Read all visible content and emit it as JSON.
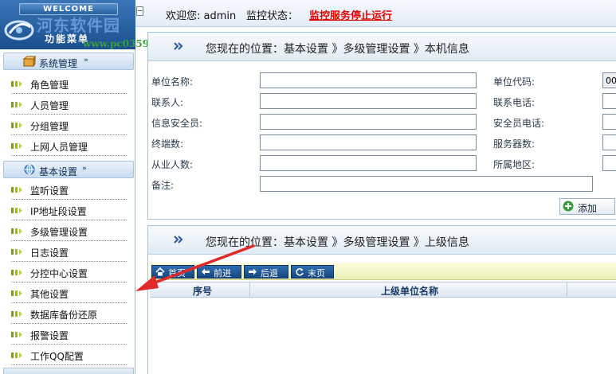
{
  "header": {
    "welcome_badge": "WELCOME",
    "menu_title": "功能菜单",
    "welcome_text": "欢迎您: admin",
    "monitor_label": "监控状态：",
    "monitor_status": "监控服务停止运行",
    "watermark_main": "河东软件园",
    "watermark_url": "www.pc0359.cn"
  },
  "sidebar": {
    "categories": [
      {
        "label": "系统管理",
        "arrow": "»",
        "items": [
          "角色管理",
          "人员管理",
          "分组管理",
          "上网人员管理"
        ]
      },
      {
        "label": "基本设置",
        "arrow": "»",
        "items": [
          "监听设置",
          "IP地址段设置",
          "多级管理设置",
          "日志设置",
          "分控中心设置",
          "其他设置",
          "数据库备份还原",
          "报警设置",
          "工作QQ配置"
        ]
      }
    ]
  },
  "panel_local": {
    "breadcrumb": "您现在的位置：基本设置 》多级管理设置 》本机信息",
    "fields_left": [
      "单位名称:",
      "联系人:",
      "信息安全员:",
      "终端数:",
      "从业人数:",
      "备注:"
    ],
    "fields_right": [
      "单位代码:",
      "联系电话:",
      "安全员电话:",
      "服务器数:",
      "所属地区:"
    ],
    "unit_code_value": "00",
    "add_label": "添加"
  },
  "panel_superior": {
    "breadcrumb": "您现在的位置：基本设置 》多级管理设置 》上级信息",
    "pager": [
      "首页",
      "前进",
      "后退",
      "末页"
    ],
    "columns": [
      "序号",
      "上级单位名称"
    ]
  },
  "colors": {
    "status_red": "#e10000",
    "nav_blue": "#1a4f8e",
    "annotation_red": "#e02a2a"
  }
}
